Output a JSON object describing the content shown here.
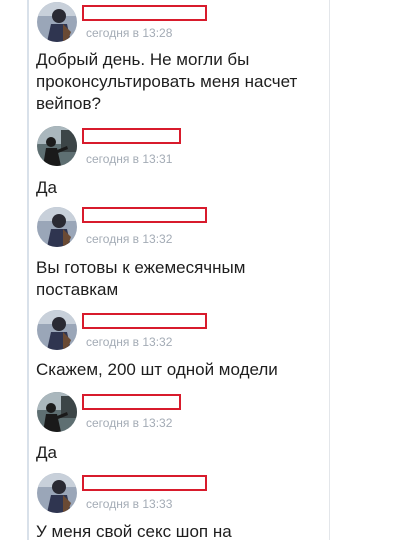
{
  "messages": [
    {
      "time": "сегодня в 13:28",
      "text": "Добрый день. Не могли бы проконсультировать меня насчет вейпов?",
      "avatar": "avatar-a"
    },
    {
      "time": "сегодня в 13:31",
      "text": "Да",
      "avatar": "avatar-b"
    },
    {
      "time": "сегодня в 13:32",
      "text": "Вы готовы к ежемесячным поставкам",
      "avatar": "avatar-a"
    },
    {
      "time": "сегодня в 13:32",
      "text": "Скажем, 200 шт одной модели",
      "avatar": "avatar-a"
    },
    {
      "time": "сегодня в 13:32",
      "text": "Да",
      "avatar": "avatar-b"
    },
    {
      "time": "сегодня в 13:33",
      "text": "У меня свой секс шоп на",
      "avatar": "avatar-a"
    }
  ],
  "colors": {
    "redaction": "#d81b2c",
    "timestamp": "#a3abb5",
    "text": "#1e1e1e"
  }
}
